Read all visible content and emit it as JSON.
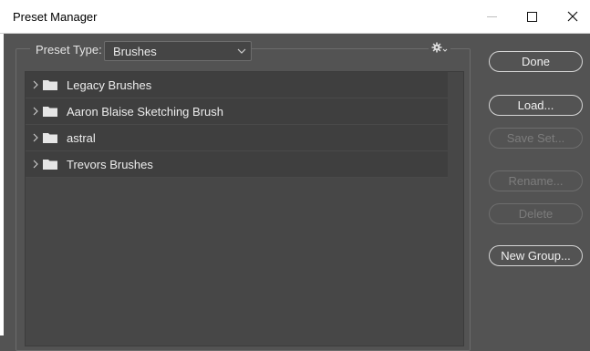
{
  "window": {
    "title": "Preset Manager"
  },
  "preset_type": {
    "label": "Preset Type:",
    "value": "Brushes"
  },
  "preset_list": [
    {
      "label": "Legacy Brushes"
    },
    {
      "label": "Aaron Blaise Sketching Brush"
    },
    {
      "label": "astral"
    },
    {
      "label": "Trevors Brushes"
    }
  ],
  "buttons": {
    "done": "Done",
    "load": "Load...",
    "save_set": "Save Set...",
    "rename": "Rename...",
    "delete": "Delete",
    "new_group": "New Group..."
  },
  "icons": {
    "gear": "gear-icon",
    "folder": "folder-icon",
    "expand": "chevron-right-icon"
  }
}
